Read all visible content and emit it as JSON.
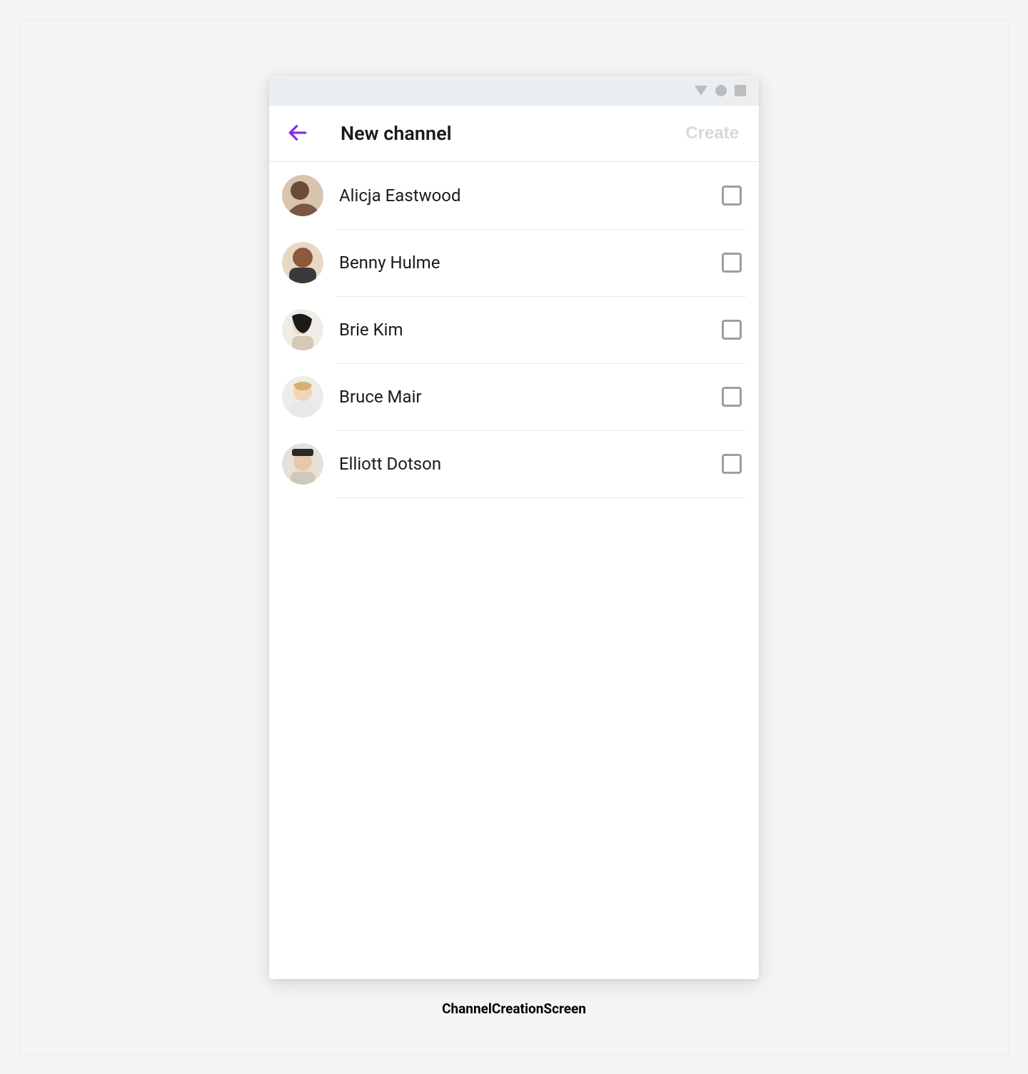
{
  "header": {
    "title": "New channel",
    "create_label": "Create"
  },
  "contacts": [
    {
      "name": "Alicja Eastwood",
      "checked": false
    },
    {
      "name": "Benny Hulme",
      "checked": false
    },
    {
      "name": "Brie Kim",
      "checked": false
    },
    {
      "name": "Bruce Mair",
      "checked": false
    },
    {
      "name": "Elliott Dotson",
      "checked": false
    }
  ],
  "caption": "ChannelCreationScreen",
  "colors": {
    "accent": "#8a2be2",
    "statusbar_icon": "#bdbdbd"
  }
}
